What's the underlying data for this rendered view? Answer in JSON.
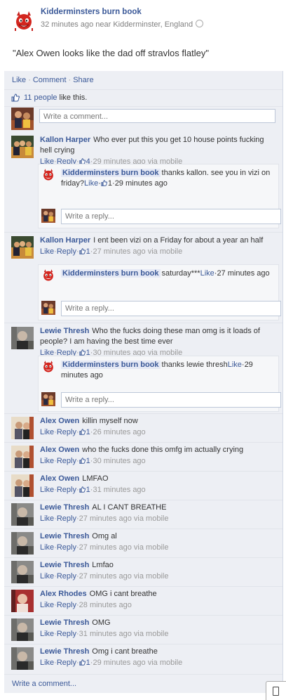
{
  "post": {
    "page_name": "Kidderminsters burn book",
    "time": "32 minutes ago near Kidderminster, England",
    "text": "\"Alex Owen looks like the dad off stravlos flatley\""
  },
  "actions": {
    "like": "Like",
    "comment": "Comment",
    "share": "Share",
    "dot": "·"
  },
  "likes": {
    "count": "11 people",
    "suffix": "like this."
  },
  "composer": {
    "placeholder": "Write a comment..."
  },
  "reply_placeholder": "Write a reply...",
  "comments": [
    {
      "author": "Kallon Harper",
      "text": "Who ever put this you get 10 house points fucking hell crying",
      "like": "Like",
      "reply": "Reply",
      "likes": "4",
      "time": "29 minutes ago via mobile",
      "replies": [
        {
          "author": "Kidderminsters burn book",
          "text": "thanks kallon. see you in vizi on friday?",
          "like": "Like",
          "likes": "1",
          "time": "29 minutes ago"
        }
      ]
    },
    {
      "author": "Kallon Harper",
      "text": "I ent been vizi on a Friday for about a year an half",
      "like": "Like",
      "reply": "Reply",
      "likes": "1",
      "time": "27 minutes ago via mobile",
      "replies": [
        {
          "author": "Kidderminsters burn book",
          "text": "saturday***",
          "like": "Like",
          "time": "27 minutes ago"
        }
      ]
    },
    {
      "author": "Lewie Thresh",
      "text": "Who the fucks doing these man omg is it loads of people? I am having the best time ever",
      "like": "Like",
      "reply": "Reply",
      "likes": "1",
      "time": "30 minutes ago via mobile",
      "replies": [
        {
          "author": "Kidderminsters burn book",
          "text": "thanks lewie thresh",
          "like": "Like",
          "time": "29 minutes ago"
        }
      ]
    },
    {
      "author": "Alex Owen",
      "text": "killin myself now",
      "like": "Like",
      "reply": "Reply",
      "likes": "1",
      "time": "26 minutes ago"
    },
    {
      "author": "Alex Owen",
      "text": "who the fucks done this omfg im actually crying",
      "like": "Like",
      "reply": "Reply",
      "likes": "1",
      "time": "30 minutes ago"
    },
    {
      "author": "Alex Owen",
      "text": "LMFAO",
      "like": "Like",
      "reply": "Reply",
      "likes": "1",
      "time": "31 minutes ago"
    },
    {
      "author": "Lewie Thresh",
      "text": "AL I CANT BREATHE",
      "like": "Like",
      "reply": "Reply",
      "time": "27 minutes ago via mobile"
    },
    {
      "author": "Lewie Thresh",
      "text": "Omg al",
      "like": "Like",
      "reply": "Reply",
      "time": "27 minutes ago via mobile"
    },
    {
      "author": "Lewie Thresh",
      "text": "Lmfao",
      "like": "Like",
      "reply": "Reply",
      "time": "27 minutes ago via mobile"
    },
    {
      "author": "Alex Rhodes",
      "text": "OMG i cant breathe",
      "like": "Like",
      "reply": "Reply",
      "time": "28 minutes ago"
    },
    {
      "author": "Lewie Thresh",
      "text": "OMG",
      "like": "Like",
      "reply": "Reply",
      "time": "31 minutes ago via mobile"
    },
    {
      "author": "Lewie Thresh",
      "text": "Omg i cant breathe",
      "like": "Like",
      "reply": "Reply",
      "likes": "1",
      "time": "29 minutes ago via mobile"
    }
  ],
  "bottom_composer": "Write a comment...",
  "colors": {
    "link": "#3b5998",
    "ufi_bg": "#edeff4",
    "devil_red": "#c8201c"
  }
}
